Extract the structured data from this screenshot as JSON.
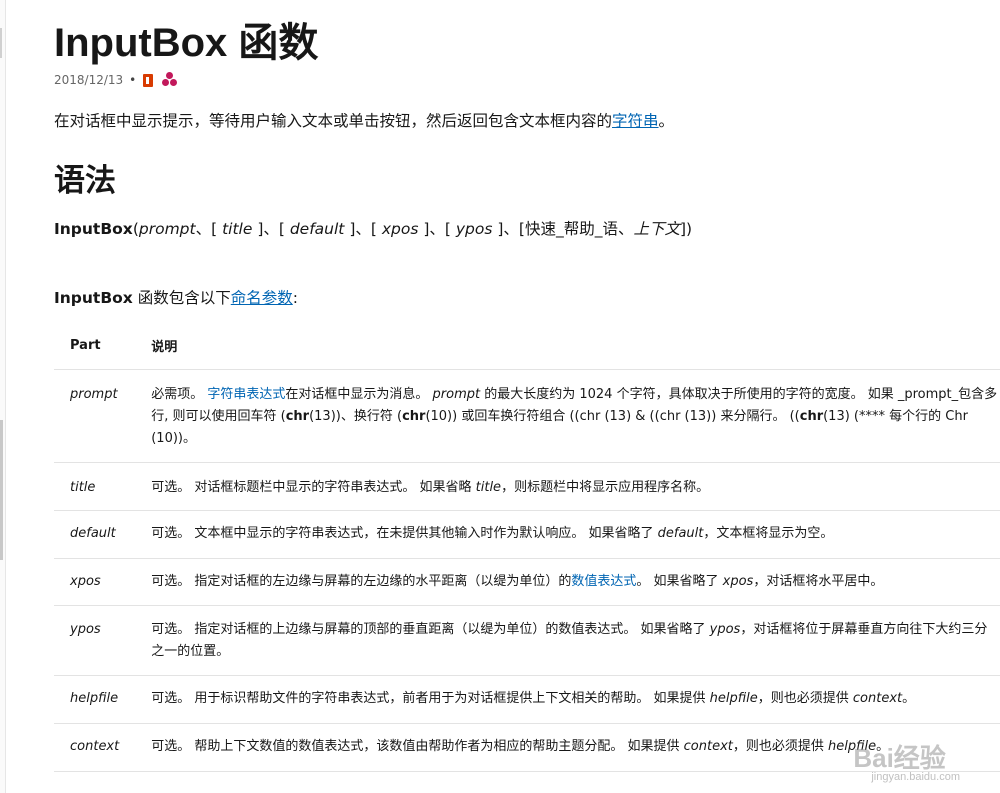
{
  "header": {
    "title": "InputBox 函数",
    "date": "2018/12/13",
    "separator": "•",
    "icons": [
      "office-icon",
      "contributors-icon"
    ]
  },
  "lead": {
    "text": "在对话框中显示提示，等待用户输入文本或单击按钮，然后返回包含文本框内容的",
    "link": "字符串",
    "end": "。"
  },
  "syntax_section": {
    "heading": "语法",
    "fn": "InputBox",
    "open": "(",
    "prompt": "prompt",
    "sep1": "、[ ",
    "title": "title",
    "sep2": " ]、[ ",
    "default": "default",
    "sep3": " ]、[ ",
    "xpos": "xpos",
    "sep4": " ]、[ ",
    "ypos": "ypos",
    "sep5": " ]、[快速_帮助_语、",
    "context": "上下文",
    "close": "])"
  },
  "params_intro": {
    "fn": "InputBox",
    "text": " 函数包含以下",
    "link": "命名参数",
    "end": ":"
  },
  "table": {
    "headers": [
      "Part",
      "说明"
    ],
    "rows": [
      {
        "part": "prompt",
        "p1": "必需项。 ",
        "link1": "字符串表达式",
        "p2": "在对话框中显示为消息。 ",
        "it1": "prompt",
        "p3": " 的最大长度约为 1024 个字符，具体取决于所使用的字符的宽度。 如果 _prompt_包含多行, 则可以使用回车符 (",
        "b1": "chr",
        "p4": "(13))、换行符 (",
        "b2": "chr",
        "p5": "(10)) 或回车换行符组合 ((chr (13) & ((chr (13)) 来分隔行。 ((",
        "b3": "chr",
        "p6": "(13) (**** 每个行的 Chr (10))。"
      },
      {
        "part": "title",
        "a": "可选。 对话框标题栏中显示的字符串表达式。 如果省略 ",
        "it": "title",
        "b": "，则标题栏中将显示应用程序名称。"
      },
      {
        "part": "default",
        "a": "可选。 文本框中显示的字符串表达式，在未提供其他输入时作为默认响应。 如果省略了 ",
        "it": "default",
        "b": "，文本框将显示为空。"
      },
      {
        "part": "xpos",
        "a": "可选。 指定对话框的左边缘与屏幕的左边缘的水平距离（以缇为单位）的",
        "link": "数值表达式",
        "b": "。 如果省略了 ",
        "it": "xpos",
        "c": "，对话框将水平居中。"
      },
      {
        "part": "ypos",
        "a": "可选。 指定对话框的上边缘与屏幕的顶部的垂直距离（以缇为单位）的数值表达式。 如果省略了 ",
        "it": "ypos",
        "b": "，对话框将位于屏幕垂直方向往下大约三分之一的位置。"
      },
      {
        "part": "helpfile",
        "a": "可选。 用于标识帮助文件的字符串表达式，前者用于为对话框提供上下文相关的帮助。 如果提供 ",
        "it": "helpfile",
        "b": "，则也必须提供 ",
        "it2": "context",
        "c": "。"
      },
      {
        "part": "context",
        "a": "可选。 帮助上下文数值的数值表达式，该数值由帮助作者为相应的帮助主题分配。 如果提供 ",
        "it": "context",
        "b": "，则也必须提供 ",
        "it2": "helpfile",
        "c": "。"
      }
    ]
  },
  "watermark": {
    "brand": "Bai经验",
    "url": "jingyan.baidu.com"
  }
}
